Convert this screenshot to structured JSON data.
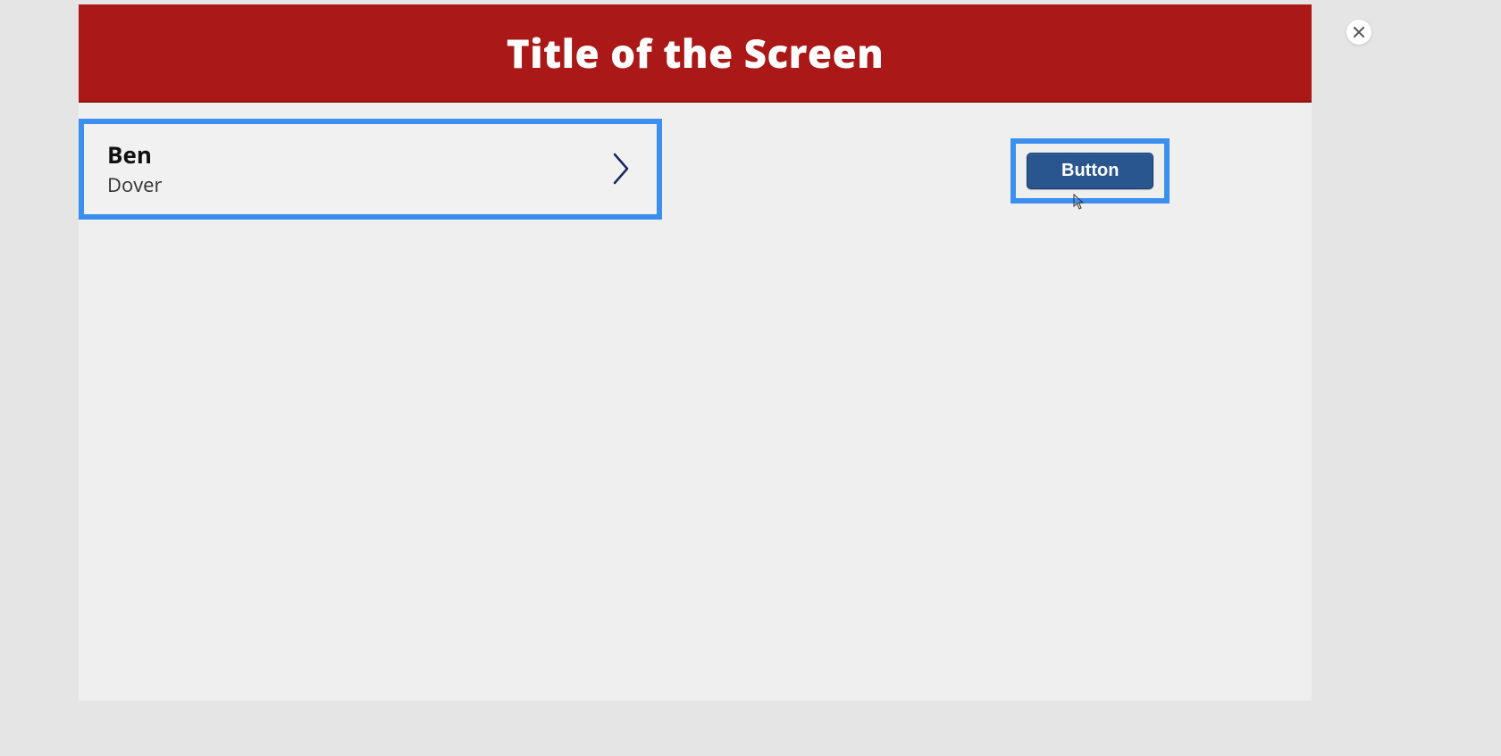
{
  "header": {
    "title": "Title of the Screen"
  },
  "list": {
    "item": {
      "primary": "Ben",
      "secondary": "Dover"
    }
  },
  "actions": {
    "button_label": "Button"
  },
  "colors": {
    "header_bg": "#ab1818",
    "highlight_border": "#3b8fee",
    "button_bg": "#2a5690"
  }
}
